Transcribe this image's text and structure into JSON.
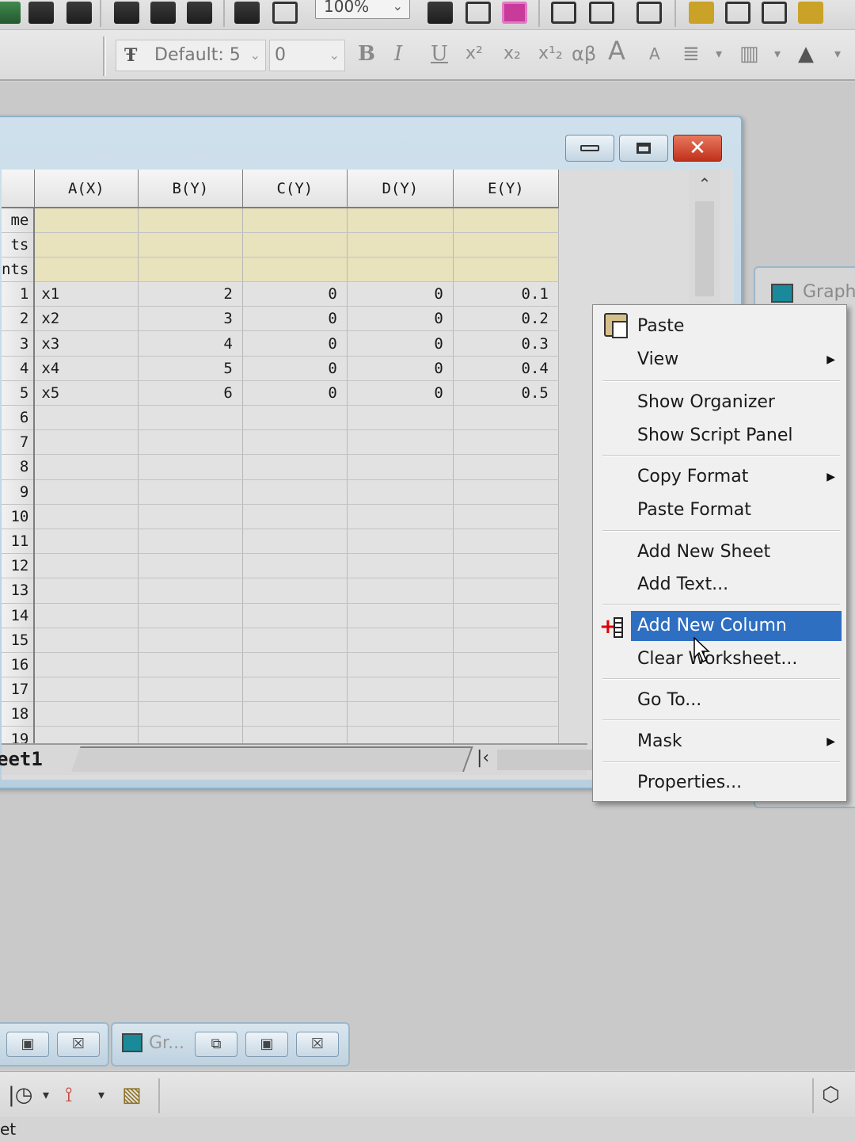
{
  "toolbar": {
    "zoom_value": "100%",
    "font_name": "Default: 5",
    "font_size": "0",
    "format_glyphs": [
      "B",
      "I",
      "U",
      "x²",
      "x₂",
      "x¹₂",
      "αβ",
      "A",
      "A"
    ]
  },
  "worksheet": {
    "columns": [
      "A(X)",
      "B(Y)",
      "C(Y)",
      "D(Y)",
      "E(Y)"
    ],
    "meta_rows": [
      "me",
      "ts",
      "nts"
    ],
    "row_numbers": [
      "1",
      "2",
      "3",
      "4",
      "5",
      "6",
      "7",
      "8",
      "9",
      "10",
      "11",
      "12",
      "13",
      "14",
      "15",
      "16",
      "17",
      "18",
      "19"
    ],
    "rows": [
      [
        "x1",
        "2",
        "0",
        "0",
        "0.1"
      ],
      [
        "x2",
        "3",
        "0",
        "0",
        "0.2"
      ],
      [
        "x3",
        "4",
        "0",
        "0",
        "0.3"
      ],
      [
        "x4",
        "5",
        "0",
        "0",
        "0.4"
      ],
      [
        "x5",
        "6",
        "0",
        "0",
        "0.5"
      ]
    ],
    "sheet_tab": "eet1"
  },
  "graph_window": {
    "title": "Graph"
  },
  "context_menu": {
    "items": [
      {
        "label": "Paste",
        "submenu": false
      },
      {
        "label": "View",
        "submenu": true
      },
      {
        "label": "Show Organizer",
        "submenu": false
      },
      {
        "label": "Show Script Panel",
        "submenu": false
      },
      {
        "label": "Copy Format",
        "submenu": true
      },
      {
        "label": "Paste Format",
        "submenu": false
      },
      {
        "label": "Add New Sheet",
        "submenu": false
      },
      {
        "label": "Add Text...",
        "submenu": false
      },
      {
        "label": "Add New Column",
        "submenu": false,
        "highlighted": true
      },
      {
        "label": "Clear Worksheet...",
        "submenu": false
      },
      {
        "label": "Go To...",
        "submenu": false
      },
      {
        "label": "Mask",
        "submenu": true
      },
      {
        "label": "Properties...",
        "submenu": false
      }
    ],
    "highlight_color": "#2f6fc2"
  },
  "minimized": {
    "graph_title": "Gr..."
  },
  "status": {
    "text": "et"
  }
}
